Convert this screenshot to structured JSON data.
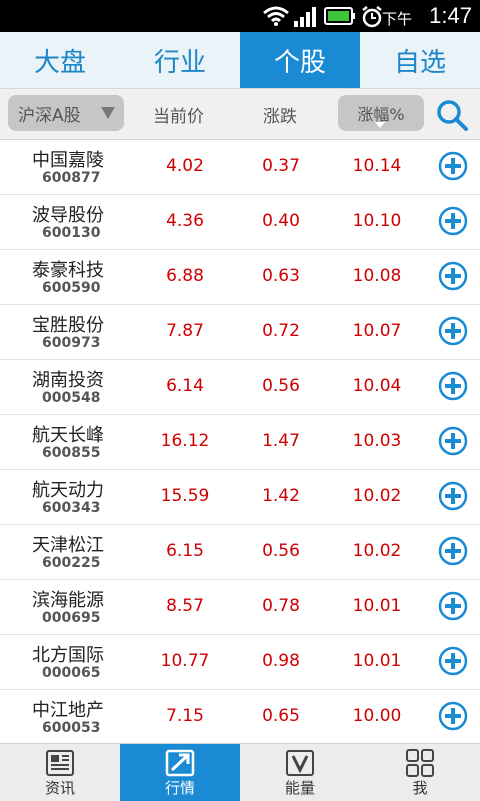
{
  "status": {
    "ampm": "下午",
    "time": "1:47"
  },
  "top_tabs": [
    {
      "label": "大盘",
      "active": false
    },
    {
      "label": "行业",
      "active": false
    },
    {
      "label": "个股",
      "active": true
    },
    {
      "label": "自选",
      "active": false
    }
  ],
  "header": {
    "market_select": "沪深A股",
    "col_price": "当前价",
    "col_change": "涨跌",
    "col_pct": "涨幅%"
  },
  "stocks": [
    {
      "name": "中国嘉陵",
      "code": "600877",
      "price": "4.02",
      "change": "0.37",
      "pct": "10.14"
    },
    {
      "name": "波导股份",
      "code": "600130",
      "price": "4.36",
      "change": "0.40",
      "pct": "10.10"
    },
    {
      "name": "泰豪科技",
      "code": "600590",
      "price": "6.88",
      "change": "0.63",
      "pct": "10.08"
    },
    {
      "name": "宝胜股份",
      "code": "600973",
      "price": "7.87",
      "change": "0.72",
      "pct": "10.07"
    },
    {
      "name": "湖南投资",
      "code": "000548",
      "price": "6.14",
      "change": "0.56",
      "pct": "10.04"
    },
    {
      "name": "航天长峰",
      "code": "600855",
      "price": "16.12",
      "change": "1.47",
      "pct": "10.03"
    },
    {
      "name": "航天动力",
      "code": "600343",
      "price": "15.59",
      "change": "1.42",
      "pct": "10.02"
    },
    {
      "name": "天津松江",
      "code": "600225",
      "price": "6.15",
      "change": "0.56",
      "pct": "10.02"
    },
    {
      "name": "滨海能源",
      "code": "000695",
      "price": "8.57",
      "change": "0.78",
      "pct": "10.01"
    },
    {
      "name": "北方国际",
      "code": "000065",
      "price": "10.77",
      "change": "0.98",
      "pct": "10.01"
    },
    {
      "name": "中江地产",
      "code": "600053",
      "price": "7.15",
      "change": "0.65",
      "pct": "10.00"
    }
  ],
  "bottom_nav": [
    {
      "label": "资讯",
      "icon": "news-icon",
      "active": false
    },
    {
      "label": "行情",
      "icon": "market-trend-icon",
      "active": true
    },
    {
      "label": "能量",
      "icon": "energy-v-icon",
      "active": false
    },
    {
      "label": "我",
      "icon": "grid-apps-icon",
      "active": false
    }
  ],
  "colors": {
    "accent": "#1a8ad4",
    "up": "#d10000"
  }
}
